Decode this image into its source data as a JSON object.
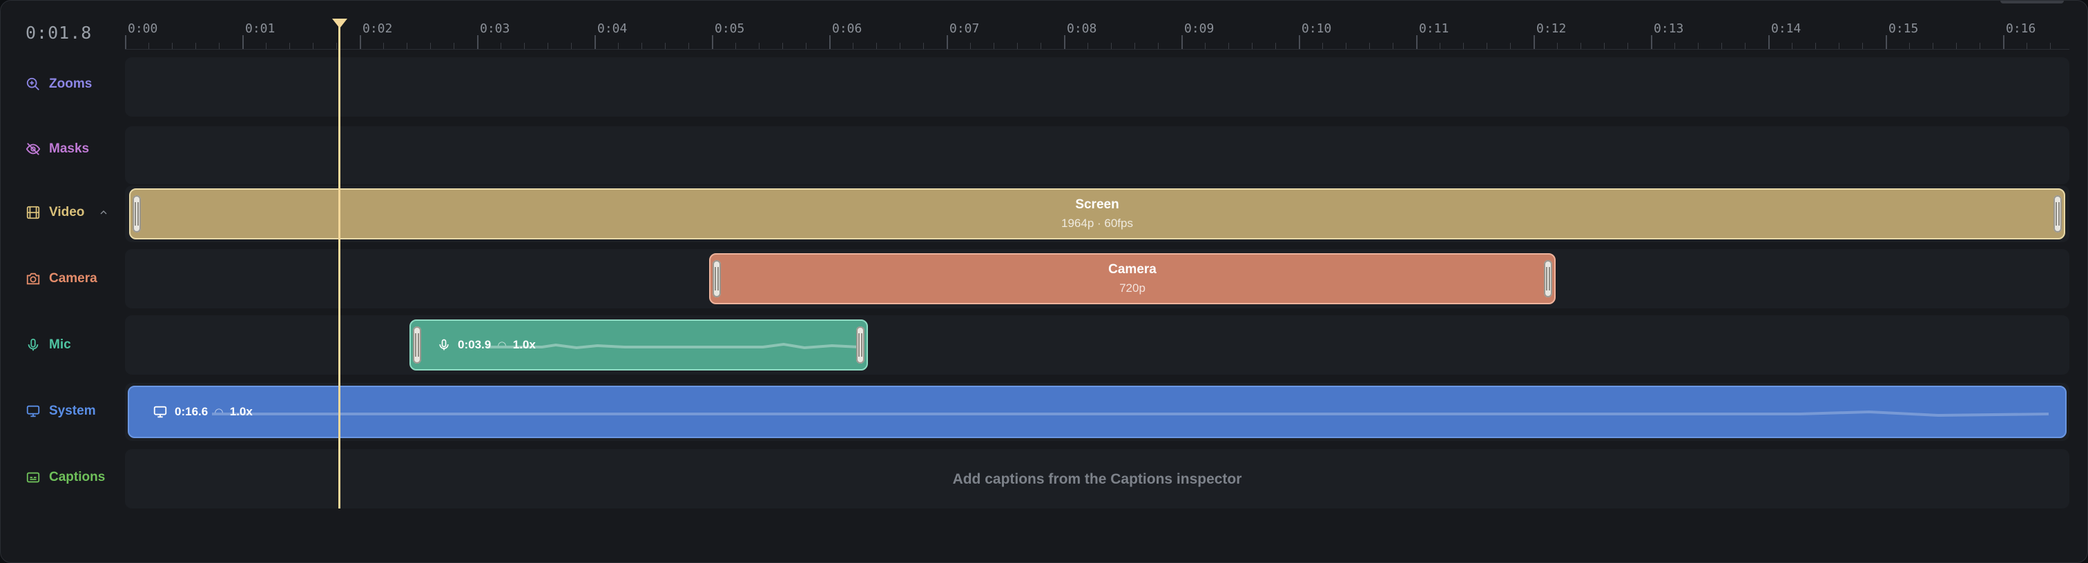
{
  "timeline": {
    "current_time": "0:01.8",
    "ruler_labels": [
      "0:00",
      "0:01",
      "0:02",
      "0:03",
      "0:04",
      "0:05",
      "0:06",
      "0:07",
      "0:08",
      "0:09",
      "0:10",
      "0:11",
      "0:12",
      "0:13",
      "0:14",
      "0:15",
      "0:16"
    ],
    "playhead_seconds": 1.8
  },
  "tracks": {
    "zooms": {
      "label": "Zooms",
      "color": "#8d86e6"
    },
    "masks": {
      "label": "Masks",
      "color": "#c07ad6"
    },
    "video": {
      "label": "Video",
      "color": "#d9c07a"
    },
    "camera": {
      "label": "Camera",
      "color": "#e48c6a"
    },
    "mic": {
      "label": "Mic",
      "color": "#4fc4a2"
    },
    "system": {
      "label": "System",
      "color": "#5a8ee6"
    },
    "captions": {
      "label": "Captions",
      "color": "#6fc05a"
    }
  },
  "clips": {
    "screen": {
      "title": "Screen",
      "subtitle": "1964p · 60fps",
      "color": "#b59f6c"
    },
    "camera": {
      "title": "Camera",
      "subtitle": "720p",
      "color": "#c97f66"
    },
    "mic": {
      "duration": "0:03.9",
      "speed": "1.0x",
      "color": "#4fa58c"
    },
    "system": {
      "duration": "0:16.6",
      "speed": "1.0x",
      "color": "#4b78c9"
    }
  },
  "captions": {
    "hint": "Add captions from the Captions inspector"
  }
}
